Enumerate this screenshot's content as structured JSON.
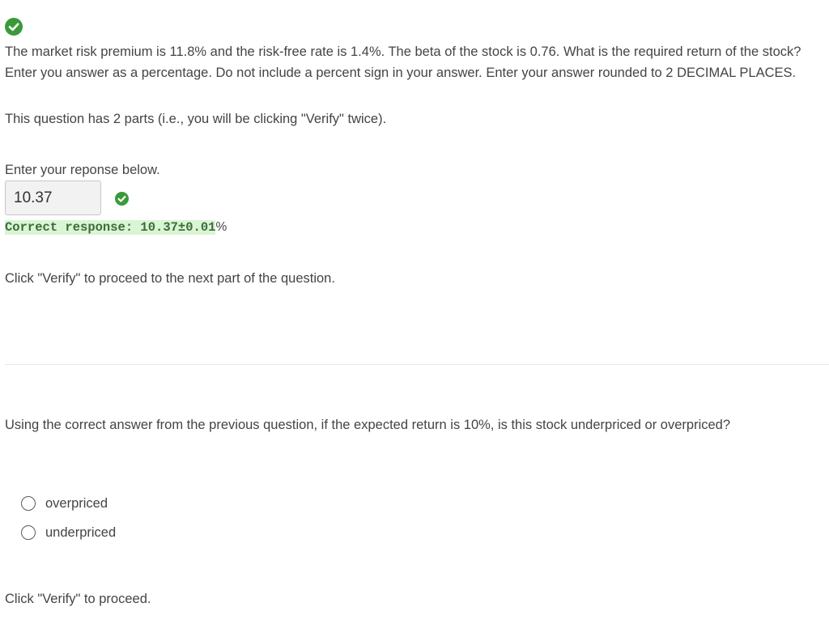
{
  "part1": {
    "status_icon": "check-circle-icon",
    "question": "The market risk premium is 11.8% and the risk-free rate is 1.4%. The beta of the stock is 0.76. What is the required return of the stock? Enter you answer as a percentage. Do not include a percent sign in your answer. Enter your answer rounded to 2 DECIMAL PLACES.",
    "parts_note": "This question has 2 parts (i.e., you will be clicking \"Verify\" twice).",
    "response_prompt": "Enter your reponse below.",
    "answer_value": "10.37",
    "correct_label": "Correct response: 10.37±0.01",
    "correct_suffix": "%",
    "verify_note": "Click \"Verify\" to proceed to the next part of the question."
  },
  "part2": {
    "question": "Using the correct answer from the previous question, if the expected return is 10%, is this stock underpriced or overpriced?",
    "options": [
      {
        "label": "overpriced",
        "selected": false
      },
      {
        "label": "underpriced",
        "selected": false
      }
    ],
    "verify_note": "Click \"Verify\" to proceed."
  },
  "colors": {
    "success_green": "#3a9a3a",
    "correct_highlight_bg": "#d9f5d3",
    "text": "#444444"
  }
}
